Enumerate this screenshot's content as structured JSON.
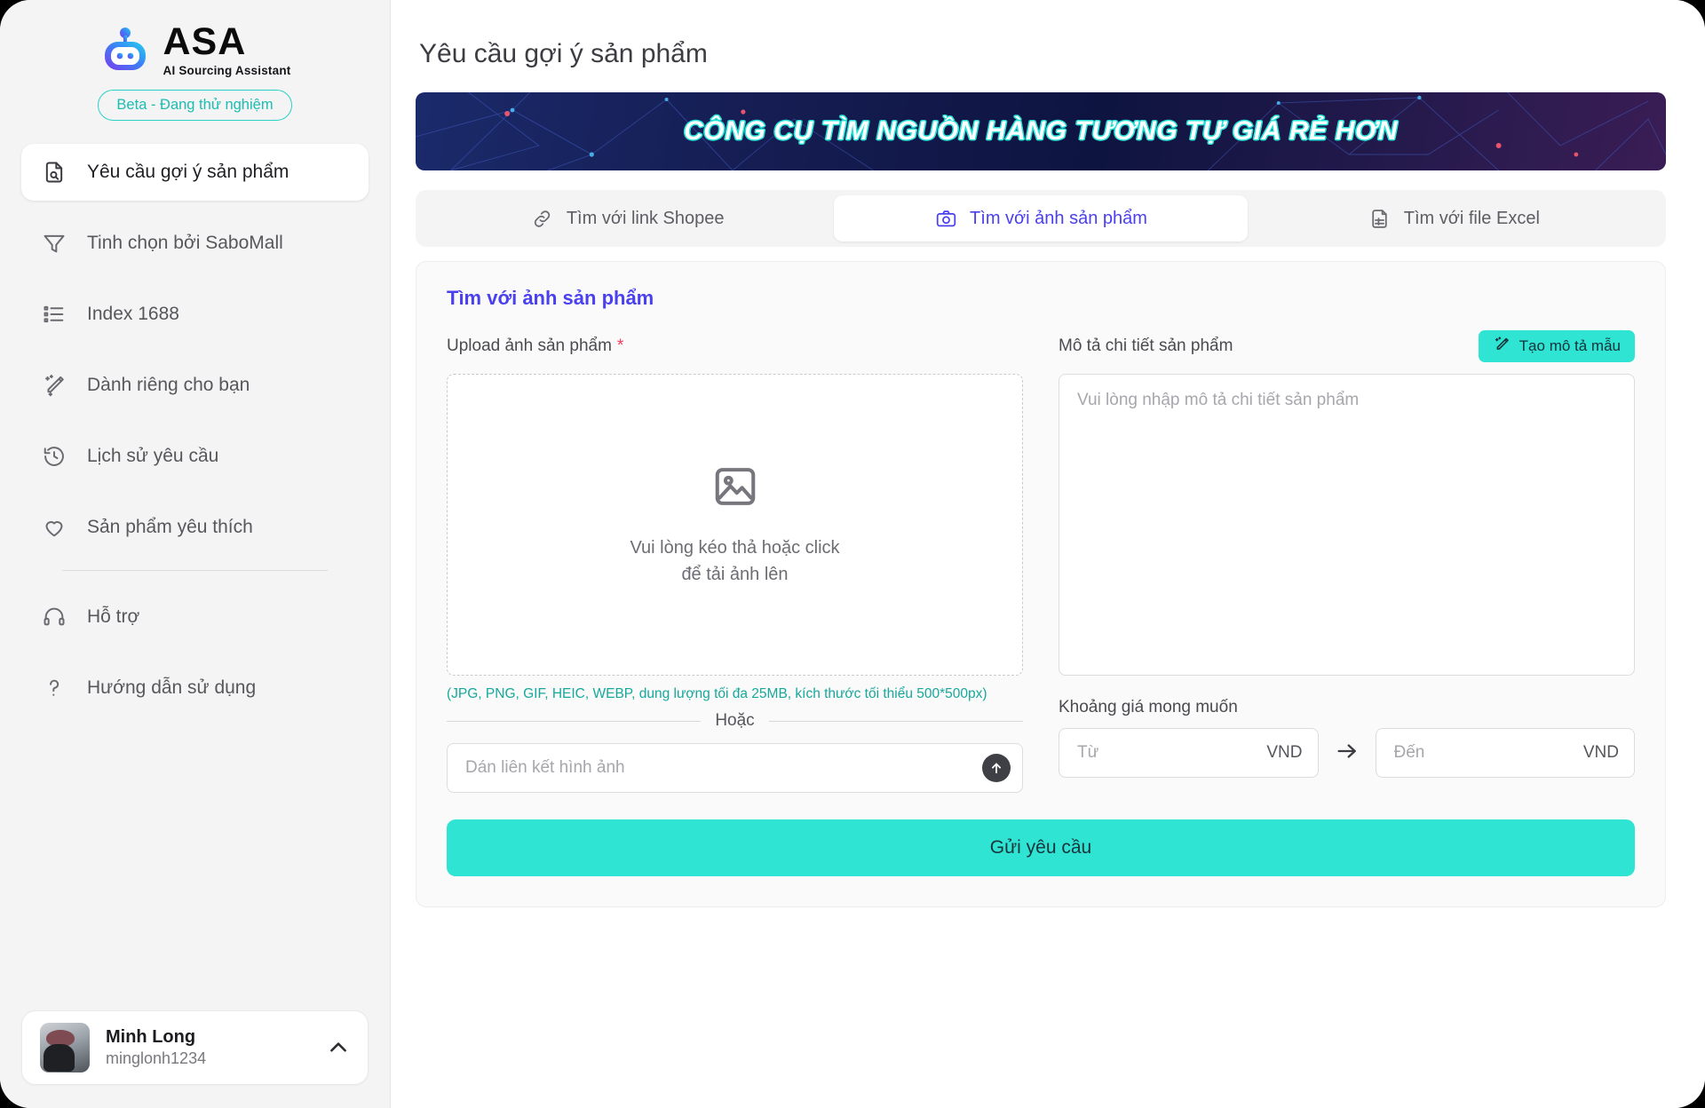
{
  "brand": {
    "name": "ASA",
    "subtitle": "AI Sourcing Assistant",
    "badge": "Beta - Đang thử nghiệm",
    "logo_icon": "robot-icon",
    "gradient_from": "#7c3aed",
    "gradient_to": "#22d3ee"
  },
  "sidebar": {
    "items": [
      {
        "label": "Yêu cầu gợi ý sản phẩm",
        "icon": "document-search-icon",
        "active": true
      },
      {
        "label": "Tinh chọn bởi SaboMall",
        "icon": "filter-funnel-icon",
        "active": false
      },
      {
        "label": "Index 1688",
        "icon": "list-icon",
        "active": false
      },
      {
        "label": "Dành riêng cho bạn",
        "icon": "magic-wand-icon",
        "active": false
      },
      {
        "label": "Lịch sử yêu cầu",
        "icon": "history-clock-icon",
        "active": false
      },
      {
        "label": "Sản phẩm yêu thích",
        "icon": "heart-icon",
        "active": false
      }
    ],
    "secondary_items": [
      {
        "label": "Hỗ trợ",
        "icon": "headphones-icon"
      },
      {
        "label": "Hướng dẫn sử dụng",
        "icon": "question-mark-icon"
      }
    ],
    "user": {
      "name": "Minh Long",
      "handle": "minglonh1234",
      "avatar_icon": "user-avatar",
      "chevron_icon": "chevron-up-icon"
    }
  },
  "main": {
    "page_title": "Yêu cầu gợi ý sản phẩm",
    "banner": {
      "text": "CÔNG CỤ TÌM NGUỒN HÀNG TƯƠNG TỰ GIÁ RẺ HƠN",
      "outline_color": "#25e0d6",
      "bg_color": "#131a4b"
    },
    "tabs": [
      {
        "label": "Tìm với link Shopee",
        "icon": "link-icon",
        "active": false
      },
      {
        "label": "Tìm với ảnh sản phẩm",
        "icon": "camera-icon",
        "active": true
      },
      {
        "label": "Tìm với file Excel",
        "icon": "csv-file-icon",
        "active": false
      }
    ],
    "accent_color": "#4a40ee",
    "panel": {
      "title": "Tìm với ảnh sản phẩm",
      "upload": {
        "label": "Upload ảnh sản phẩm",
        "required_mark": "*",
        "dropzone_icon": "image-placeholder-icon",
        "dropzone_line1": "Vui lòng kéo thả hoặc click",
        "dropzone_line2": "để tải ảnh lên",
        "hint": "(JPG, PNG, GIF, HEIC, WEBP, dung lượng tối đa 25MB, kích thước tối thiểu 500*500px)",
        "hint_color": "#16a89b",
        "divider_label": "Hoặc",
        "link_placeholder": "Dán liên kết hình ảnh",
        "link_value": "",
        "submit_link_icon": "arrow-up-circle-icon"
      },
      "description": {
        "label": "Mô tả chi tiết sản phẩm",
        "generate_button": "Tạo mô tả mẫu",
        "generate_icon": "magic-wand-icon",
        "generate_color": "#2fe4d3",
        "placeholder": "Vui lòng nhập mô tả chi tiết sản phẩm",
        "value": ""
      },
      "price": {
        "label": "Khoảng giá mong muốn",
        "from_placeholder": "Từ",
        "from_value": "",
        "to_placeholder": "Đến",
        "to_value": "",
        "currency": "VND",
        "arrow_icon": "arrow-right-icon"
      },
      "submit_label": "Gửi yêu cầu",
      "submit_color": "#2fe4d3"
    }
  }
}
